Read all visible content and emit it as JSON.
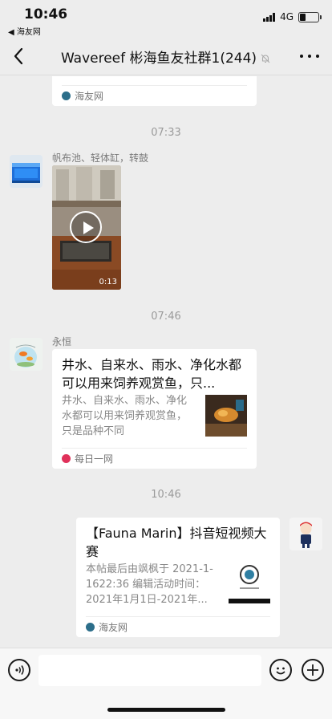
{
  "status": {
    "time": "10:46",
    "back_app": "◀ 海友网",
    "network": "4G",
    "battery_level": 0.3
  },
  "nav": {
    "title": "Wavereef 彬海鱼友社群1(244)"
  },
  "messages": {
    "partial_card": {
      "source": "海友网",
      "source_color": "#2c6e8a"
    },
    "ts1": "07:33",
    "video_msg": {
      "sender": "帆布池、轻体缸，转鼓",
      "duration": "0:13"
    },
    "ts2": "07:46",
    "link1": {
      "sender": "永恒",
      "title": "井水、自来水、雨水、净化水都可以用来饲养观赏鱼，只...",
      "desc": "井水、自来水、雨水、净化水都可以用来饲养观赏鱼，只是品种不同",
      "source": "每日一网",
      "source_color": "#e0315a"
    },
    "ts3": "10:46",
    "link2": {
      "title": "【Fauna Marin】抖音短视频大赛",
      "desc": "本帖最后由飒枫于 2021-1-1622:36 编辑活动时间：2021年1月1日-2021年...",
      "source": "海友网",
      "source_color": "#2c6e8a"
    }
  }
}
